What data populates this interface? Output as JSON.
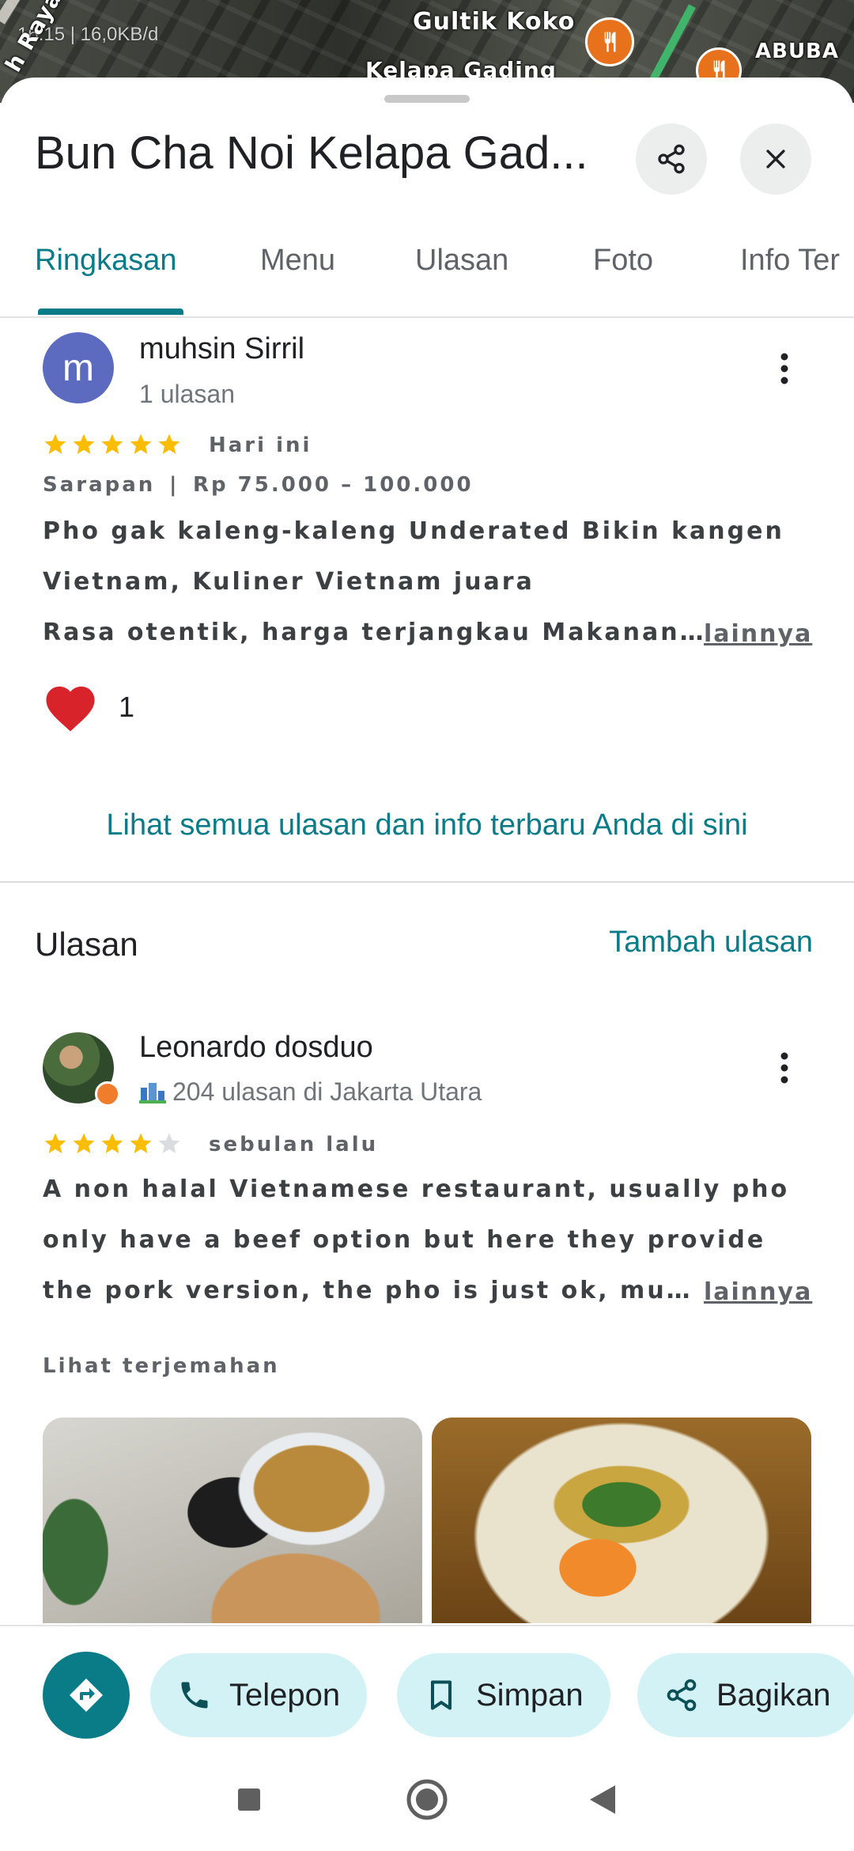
{
  "map": {
    "status_text": "16:15 | 16,0KB/d",
    "labels": [
      "Gultik Koko",
      "Kelapa Gading",
      "ABUBA",
      "h Raya"
    ]
  },
  "place": {
    "title": "Bun Cha Noi Kelapa Gad...",
    "share_icon": "share-icon",
    "close_icon": "close-icon"
  },
  "tabs": [
    {
      "label": "Ringkasan",
      "active": true
    },
    {
      "label": "Menu",
      "active": false
    },
    {
      "label": "Ulasan",
      "active": false
    },
    {
      "label": "Foto",
      "active": false
    },
    {
      "label": "Info Ter",
      "active": false
    }
  ],
  "review1": {
    "avatar_letter": "m",
    "name": "muhsin Sirril",
    "sub": "1 ulasan",
    "rating": 5,
    "time": "Hari ini",
    "meal": "Sarapan",
    "separator": "|",
    "price": "Rp 75.000 – 100.000",
    "lines": [
      "Pho gak kaleng-kaleng Underated  Bikin kangen",
      "Vietnam, Kuliner Vietnam juara",
      "Rasa otentik, harga terjangkau Makanan…"
    ],
    "more": "lainnya",
    "likes": "1"
  },
  "see_all": "Lihat semua ulasan dan info terbaru Anda di sini",
  "reviews_section": {
    "title": "Ulasan",
    "add_label": "Tambah ulasan"
  },
  "review2": {
    "name": "Leonardo dosduo",
    "sub": "204 ulasan di Jakarta Utara",
    "rating": 4,
    "time": "sebulan lalu",
    "lines": [
      "A non halal Vietnamese restaurant, usually pho",
      "only have a beef option but here they provide",
      "the pork version, the pho is just ok, mu…"
    ],
    "more": "lainnya",
    "translate": "Lihat terjemahan"
  },
  "actions": {
    "directions_icon": "directions-icon",
    "call": "Telepon",
    "save": "Simpan",
    "share": "Bagikan"
  },
  "colors": {
    "accent": "#0a7c88",
    "pill": "#d2f2f6",
    "star": "#fbbc04",
    "heart": "#d8232a"
  }
}
